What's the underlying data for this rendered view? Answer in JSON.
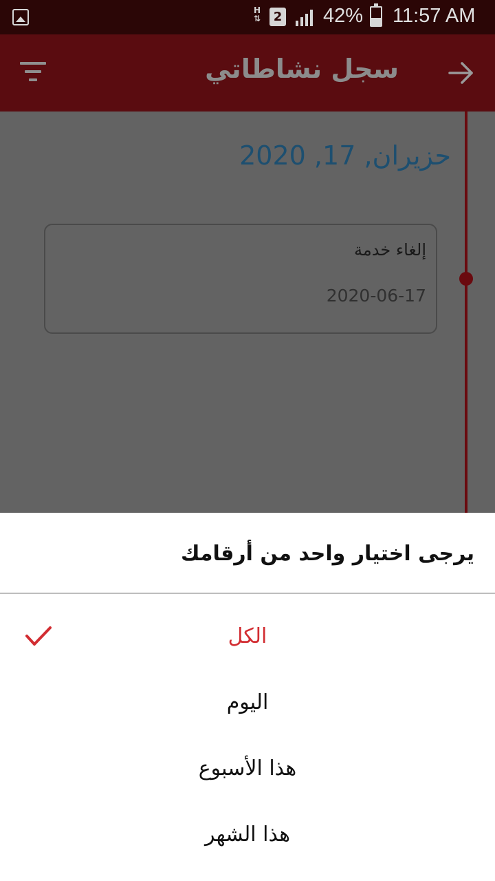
{
  "status_bar": {
    "network_h": "H",
    "sim_slot": "2",
    "battery_percent": "42%",
    "battery_level": 0.42,
    "time": "11:57 AM",
    "icons": [
      "gallery-icon",
      "h-network-icon",
      "sim-2-icon",
      "signal-icon",
      "battery-icon"
    ]
  },
  "app_bar": {
    "title": "سجل نشاطاتي",
    "icons": [
      "filter-icon",
      "back-arrow-icon"
    ]
  },
  "timeline": {
    "date_heading": "حزيران, 17, 2020",
    "entries": [
      {
        "title": "إلغاء خدمة",
        "date": "2020-06-17"
      }
    ]
  },
  "sheet": {
    "title": "يرجى اختيار واحد من أرقامك",
    "options": [
      {
        "label": "الكل",
        "selected": true
      },
      {
        "label": "اليوم",
        "selected": false
      },
      {
        "label": "هذا الأسبوع",
        "selected": false
      },
      {
        "label": "هذا الشهر",
        "selected": false
      }
    ]
  },
  "colors": {
    "status_bar_bg": "#2b0606",
    "app_bar_bg": "#5a0c10",
    "timeline_accent": "#6a0a0f",
    "date_heading": "#1d4f70",
    "selected_option": "#d22d32",
    "overlay": "#636363"
  }
}
